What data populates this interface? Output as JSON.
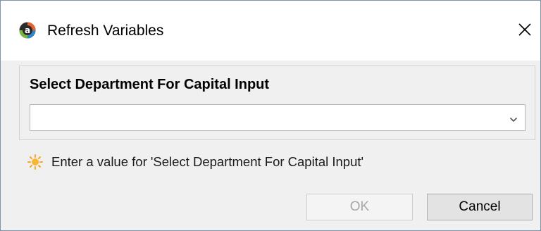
{
  "window": {
    "title": "Refresh Variables",
    "icon": "app-logo-icon",
    "close_icon": "close-icon"
  },
  "group": {
    "label": "Select Department For Capital Input",
    "combo": {
      "value": "",
      "icon": "chevron-down-icon"
    }
  },
  "hint": {
    "icon": "sun-icon",
    "text": "Enter a value for 'Select Department For Capital Input'"
  },
  "buttons": {
    "ok_label": "OK",
    "ok_enabled": false,
    "cancel_label": "Cancel"
  },
  "colors": {
    "border": "#7d93ad",
    "dialog_bg": "#f0f0f0",
    "hint_icon": "#f5a623",
    "disabled_text": "#a8a8a8"
  }
}
